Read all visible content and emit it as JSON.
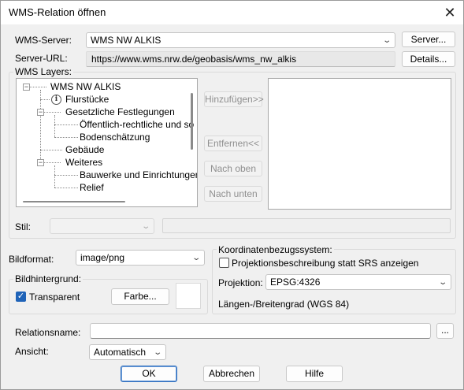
{
  "window": {
    "title": "WMS-Relation öffnen",
    "close_glyph": "✕"
  },
  "server": {
    "label": "WMS-Server:",
    "value": "WMS NW ALKIS",
    "button": "Server...",
    "url_label": "Server-URL:",
    "url": "https://www.wms.nrw.de/geobasis/wms_nw_alkis",
    "details_button": "Details..."
  },
  "layers": {
    "label": "WMS Layers:",
    "tree": [
      "WMS NW ALKIS",
      "Flurstücke",
      "Gesetzliche Festlegungen",
      "Öffentlich-rechtliche und so",
      "Bodenschätzung",
      "Gebäude",
      "Weiteres",
      "Bauwerke und Einrichtungen",
      "Relief"
    ],
    "add_button": "Hinzufügen>>",
    "remove_button": "Entfernen<<",
    "move_up_button": "Nach oben",
    "move_down_button": "Nach unten",
    "style_label": "Stil:"
  },
  "image": {
    "format_label": "Bildformat:",
    "format_value": "image/png",
    "background_group": "Bildhintergrund:",
    "transparent_label": "Transparent",
    "transparent_checked": true,
    "color_button": "Farbe..."
  },
  "crs": {
    "group_label": "Koordinatenbezugssystem:",
    "projection_desc_label": "Projektionsbeschreibung statt SRS anzeigen",
    "projection_desc_checked": false,
    "projection_label": "Projektion:",
    "projection_value": "EPSG:4326",
    "description": "Längen-/Breitengrad (WGS 84)"
  },
  "relation": {
    "name_label": "Relationsname:",
    "name_value": "",
    "browse_button": "...",
    "view_label": "Ansicht:",
    "view_value": "Automatisch"
  },
  "footer": {
    "ok": "OK",
    "cancel": "Abbrechen",
    "help": "Hilfe"
  },
  "colors": {
    "accent": "#1f63b8",
    "default_button_border": "#2f6ebf"
  }
}
